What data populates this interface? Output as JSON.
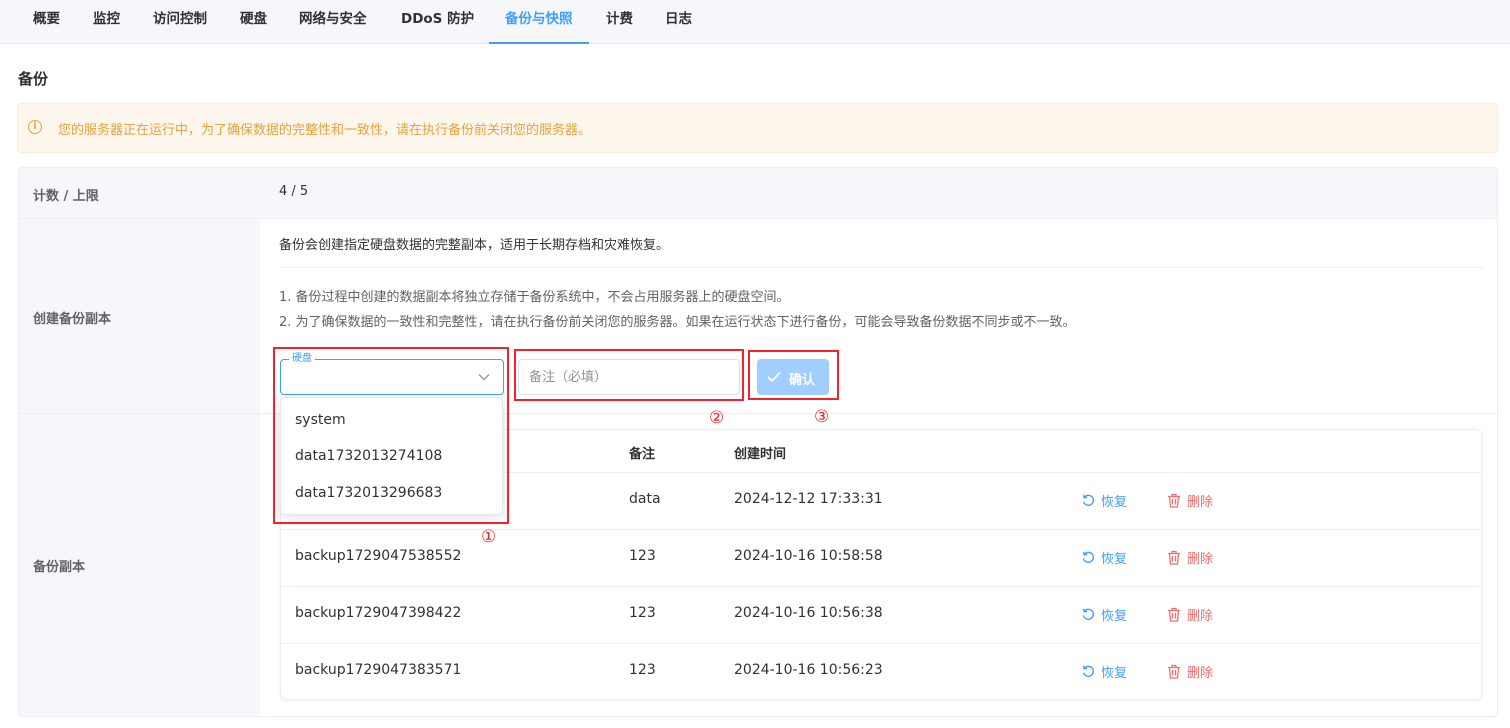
{
  "tabs": [
    "概要",
    "监控",
    "访问控制",
    "硬盘",
    "网络与安全",
    "DDoS 防护",
    "备份与快照",
    "计费",
    "日志"
  ],
  "active_tab": "备份与快照",
  "section_title": "备份",
  "alert": {
    "text": "您的服务器正在运行中，为了确保数据的完整性和一致性，请在执行备份前关闭您的服务器。",
    "color": "#e6a23c"
  },
  "count": {
    "label": "计数 / 上限",
    "value": "4 / 5"
  },
  "create": {
    "label": "创建备份副本",
    "intro": "备份会创建指定硬盘数据的完整副本，适用于长期存档和灾难恢复。",
    "notes": [
      "1. 备份过程中创建的数据副本将独立存储于备份系统中，不会占用服务器上的硬盘空间。",
      "2. 为了确保数据的一致性和完整性，请在执行备份前关闭您的服务器。如果在运行状态下进行备份，可能会导致备份数据不同步或不一致。"
    ],
    "disk_select": {
      "label": "硬盘",
      "value": "",
      "options": [
        "system",
        "data1732013274108",
        "data1732013296683"
      ]
    },
    "remark_placeholder": "备注（必填）",
    "confirm_label": "确认"
  },
  "annotations": [
    "①",
    "②",
    "③"
  ],
  "backups": {
    "label": "备份副本",
    "columns": [
      "备注",
      "创建时间"
    ],
    "restore_label": "恢复",
    "delete_label": "删除",
    "rows": [
      {
        "name": "",
        "remark": "data",
        "time": "2024-12-12 17:33:31"
      },
      {
        "name": "backup1729047538552",
        "remark": "123",
        "time": "2024-10-16 10:58:58"
      },
      {
        "name": "backup1729047398422",
        "remark": "123",
        "time": "2024-10-16 10:56:38"
      },
      {
        "name": "backup1729047383571",
        "remark": "123",
        "time": "2024-10-16 10:56:23"
      }
    ]
  },
  "colors": {
    "accent": "#409eff",
    "danger": "#f56c6c",
    "annotation": "#f5222d"
  }
}
